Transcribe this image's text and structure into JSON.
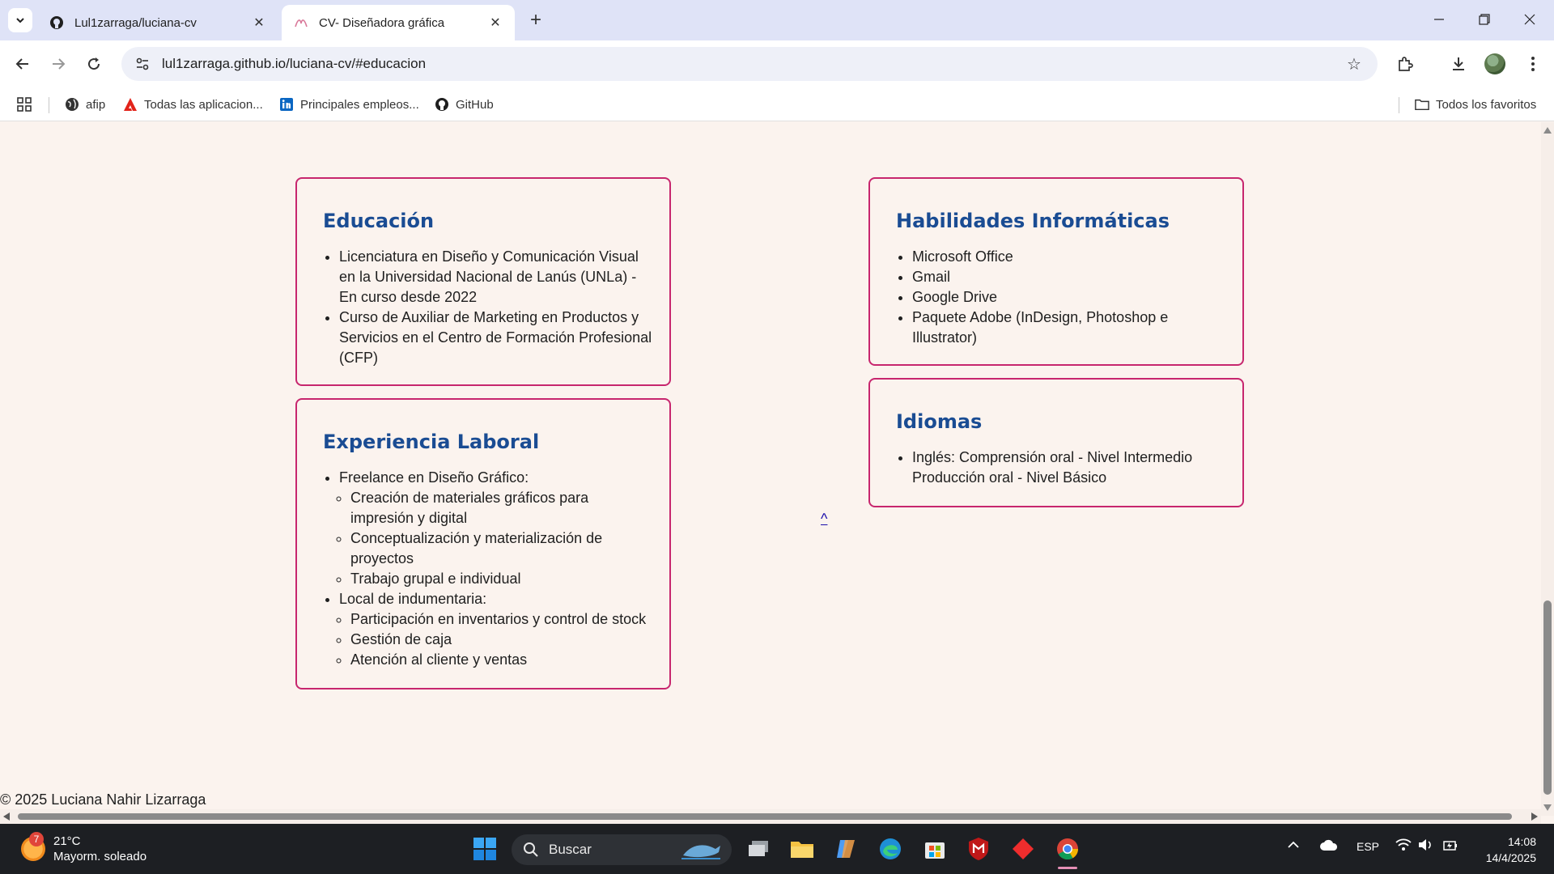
{
  "browser": {
    "tabs": [
      {
        "title": "Lul1zarraga/luciana-cv",
        "active": false,
        "icon": "github-icon"
      },
      {
        "title": "CV- Diseñadora gráfica",
        "active": true,
        "icon": "page-favicon-icon"
      }
    ],
    "url": "lul1zarraga.github.io/luciana-cv/#educacion",
    "bookmarks": [
      {
        "label": "afip",
        "icon": "globe-icon"
      },
      {
        "label": "Todas las aplicacion...",
        "icon": "adobe-icon"
      },
      {
        "label": "Principales empleos...",
        "icon": "linkedin-icon"
      },
      {
        "label": "GitHub",
        "icon": "github-icon"
      }
    ],
    "all_bookmarks_label": "Todos los favoritos"
  },
  "page": {
    "education": {
      "title": "Educación",
      "items": [
        "Licenciatura en Diseño y Comunicación Visual en la Universidad Nacional de Lanús (UNLa) - En curso desde 2022",
        "Curso de Auxiliar de Marketing en Productos y Servicios en el Centro de Formación Profesional (CFP)"
      ]
    },
    "experience": {
      "title": "Experiencia Laboral",
      "jobs": [
        {
          "label": "Freelance en Diseño Gráfico:",
          "tasks": [
            "Creación de materiales gráficos para impresión y digital",
            "Conceptualización y materialización de proyectos",
            "Trabajo grupal e individual"
          ]
        },
        {
          "label": "Local de indumentaria:",
          "tasks": [
            "Participación en inventarios y control de stock",
            "Gestión de caja",
            "Atención al cliente y ventas"
          ]
        }
      ]
    },
    "skills": {
      "title": "Habilidades Informáticas",
      "items": [
        "Microsoft Office",
        "Gmail",
        "Google Drive",
        "Paquete Adobe (InDesign, Photoshop e Illustrator)"
      ]
    },
    "languages": {
      "title": "Idiomas",
      "items": [
        "Inglés: Comprensión oral - Nivel Intermedio Producción oral - Nivel Básico"
      ]
    },
    "back_to_top": "^",
    "footer": "© 2025 Luciana Nahir Lizarraga"
  },
  "taskbar": {
    "weather_badge": "7",
    "temperature": "21°C",
    "condition": "Mayorm. soleado",
    "search_label": "Buscar",
    "language": "ESP",
    "time": "14:08",
    "date": "14/4/2025"
  },
  "colors": {
    "accent_border": "#c7266e",
    "heading": "#1a4c93",
    "page_bg": "#fbf3ee"
  }
}
